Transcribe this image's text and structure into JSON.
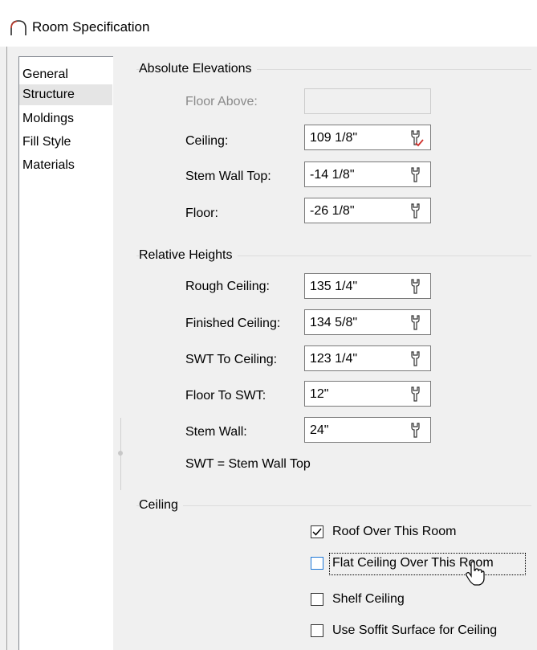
{
  "window": {
    "title": "Room Specification"
  },
  "sidebar": {
    "items": [
      {
        "label": "General",
        "selected": false
      },
      {
        "label": "Structure",
        "selected": true
      },
      {
        "label": "Moldings",
        "selected": false
      },
      {
        "label": "Fill Style",
        "selected": false
      },
      {
        "label": "Materials",
        "selected": false
      }
    ]
  },
  "absolute_elevations": {
    "title": "Absolute Elevations",
    "floor_above": {
      "label": "Floor Above:",
      "value": "",
      "enabled": false
    },
    "ceiling": {
      "label": "Ceiling:",
      "value": "109 1/8\""
    },
    "stem_wall_top": {
      "label": "Stem Wall Top:",
      "value": "-14 1/8\""
    },
    "floor": {
      "label": "Floor:",
      "value": "-26 1/8\""
    }
  },
  "relative_heights": {
    "title": "Relative Heights",
    "rough_ceiling": {
      "label": "Rough Ceiling:",
      "value": "135 1/4\""
    },
    "finished_ceiling": {
      "label": "Finished Ceiling:",
      "value": "134 5/8\""
    },
    "swt_to_ceiling": {
      "label": "SWT To Ceiling:",
      "value": "123 1/4\""
    },
    "floor_to_swt": {
      "label": "Floor To SWT:",
      "value": "12\""
    },
    "stem_wall": {
      "label": "Stem Wall:",
      "value": "24\""
    },
    "note": "SWT = Stem Wall Top"
  },
  "ceiling": {
    "title": "Ceiling",
    "options": [
      {
        "label": "Roof Over This Room",
        "checked": true
      },
      {
        "label": "Flat Ceiling Over This Room",
        "checked": false,
        "focused": true
      },
      {
        "label": "Shelf Ceiling",
        "checked": false
      },
      {
        "label": "Use Soffit Surface for Ceiling",
        "checked": false
      }
    ]
  },
  "colors": {
    "accent_check": "#1e78d7",
    "dialog_bg": "#f0f0f0",
    "selected_item_bg": "#e5e5e5"
  }
}
